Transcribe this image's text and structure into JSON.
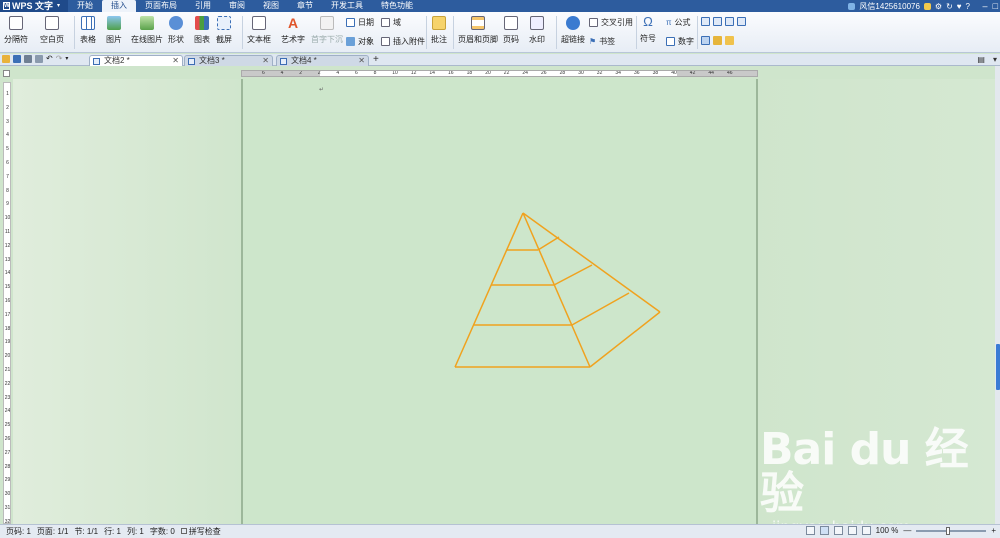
{
  "app": {
    "title": "WPS 文字"
  },
  "menu": [
    {
      "label": "开始"
    },
    {
      "label": "插入",
      "active": true
    },
    {
      "label": "页面布局"
    },
    {
      "label": "引用"
    },
    {
      "label": "审阅"
    },
    {
      "label": "视图"
    },
    {
      "label": "章节"
    },
    {
      "label": "开发工具"
    },
    {
      "label": "特色功能"
    }
  ],
  "user": {
    "name": "风信1425610076"
  },
  "ribbon": {
    "page_break": "分隔符",
    "blank_page": "空白页",
    "table": "表格",
    "picture": "图片",
    "online_picture": "在线图片",
    "shapes": "形状",
    "chart": "图表",
    "screenshot": "截屏",
    "textbox": "文本框",
    "wordart": "艺术字",
    "dropcap": "首字下沉",
    "date": "日期",
    "field": "域",
    "object": "对象",
    "attachment": "插入附件",
    "comment": "批注",
    "header_footer": "页眉和页脚",
    "page_number": "页码",
    "watermark": "水印",
    "hyperlink": "超链接",
    "cross_ref": "交叉引用",
    "bookmark": "书签",
    "symbol": "符号",
    "formula": "公式",
    "number": "数字"
  },
  "tabs": [
    {
      "label": "文档2 *",
      "active": true
    },
    {
      "label": "文档3 *"
    },
    {
      "label": "文档4 *"
    }
  ],
  "ruler_h": [
    "6",
    "4",
    "2",
    "2",
    "4",
    "6",
    "8",
    "10",
    "12",
    "14",
    "16",
    "18",
    "20",
    "22",
    "24",
    "26",
    "28",
    "30",
    "32",
    "34",
    "36",
    "38",
    "40",
    "42",
    "44",
    "46"
  ],
  "ruler_v": [
    "1",
    "2",
    "3",
    "4",
    "5",
    "6",
    "7",
    "8",
    "9",
    "10",
    "11",
    "12",
    "13",
    "14",
    "15",
    "16",
    "17",
    "18",
    "19",
    "20",
    "21",
    "22",
    "23",
    "24",
    "25",
    "26",
    "27",
    "28",
    "29",
    "30",
    "31",
    "32"
  ],
  "status": {
    "page_number": "页码: 1",
    "pages": "页面: 1/1",
    "section": "节: 1/1",
    "row": "行: 1",
    "column": "列: 1",
    "word_count": "字数: 0",
    "spell_check": "拼写检查",
    "zoom": "100 %",
    "zoom_level": 0.45
  },
  "watermark": {
    "brand": "Bai du 经验",
    "url": "jingyan.baidu.com"
  },
  "colors": {
    "pyramid_stroke": "#f0a21e",
    "doc_bg": "#cde6cb",
    "title_bar": "#2d5c9e"
  }
}
